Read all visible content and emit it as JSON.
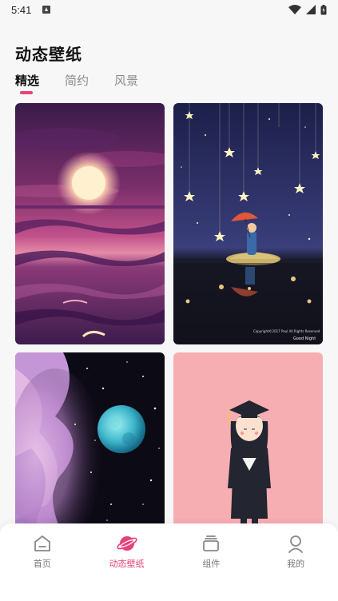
{
  "status_bar": {
    "time": "5:41",
    "icons": [
      "notification-a-icon",
      "wifi-icon",
      "signal-icon",
      "battery-icon"
    ]
  },
  "header": {
    "title": "动态壁纸"
  },
  "tabs": [
    {
      "label": "精选",
      "active": true
    },
    {
      "label": "简约",
      "active": false
    },
    {
      "label": "风景",
      "active": false
    }
  ],
  "wallpapers": [
    {
      "subject": "sunset-over-purple-sea",
      "watermark": ""
    },
    {
      "subject": "boy-with-umbrella-under-stars",
      "watermark": "Copyright©2017 Paul All Rights Reserved",
      "caption": "Good Night"
    },
    {
      "subject": "galaxy-moon-nebula",
      "watermark": ""
    },
    {
      "subject": "graduate-girl-pink",
      "watermark": ""
    }
  ],
  "bottom_nav": {
    "items": [
      {
        "label": "首页",
        "icon": "home-icon",
        "active": false
      },
      {
        "label": "动态壁纸",
        "icon": "planet-icon",
        "active": true
      },
      {
        "label": "组件",
        "icon": "widget-stack-icon",
        "active": false
      },
      {
        "label": "我的",
        "icon": "profile-icon",
        "active": false
      }
    ]
  },
  "colors": {
    "accent": "#e8427c",
    "background": "#f7f7f7"
  }
}
